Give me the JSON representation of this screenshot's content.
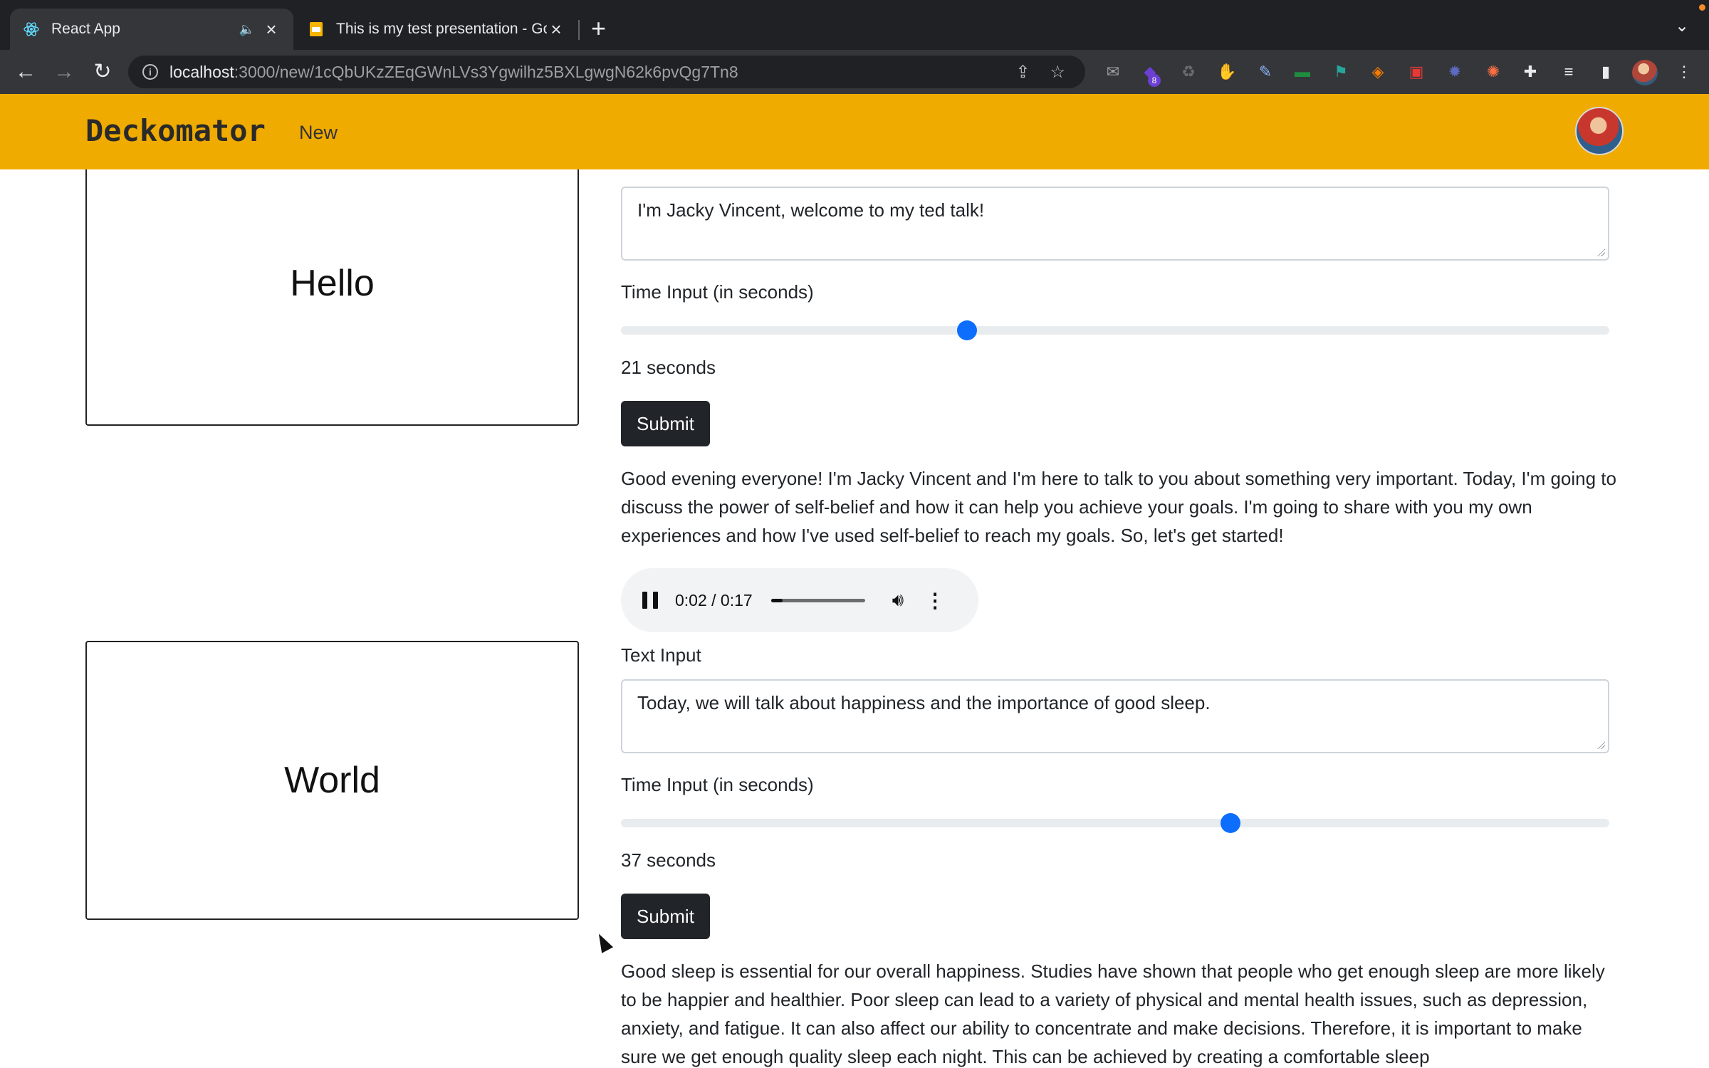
{
  "browser": {
    "tabs": [
      {
        "title": "React App",
        "active": true
      },
      {
        "title": "This is my test presentation - Google Slides",
        "active": false
      }
    ],
    "url_host": "localhost",
    "url_rest": ":3000/new/1cQbUKzZEqGWnLVs3Ygwilhz5BXLgwgN62k6pvQg7Tn8",
    "extension_badge": "8"
  },
  "app": {
    "brand": "Deckomator",
    "nav_new": "New"
  },
  "slides": [
    {
      "slide_text": "Hello",
      "text_value": "I'm Jacky Vincent, welcome to my ted talk!",
      "time_label": "Time Input (in seconds)",
      "time_value": 21,
      "seconds_text": "21 seconds",
      "submit_label": "Submit",
      "generated_text": "Good evening everyone! I'm Jacky Vincent and I'm here to talk to you about something very important. Today, I'm going to discuss the power of self-belief and how it can help you achieve your goals. I'm going to share with you my own experiences and how I've used self-belief to reach my goals. So, let's get started!",
      "audio": {
        "time": "0:02 / 0:17",
        "progress": 0.12
      }
    },
    {
      "slide_text": "World",
      "text_label": "Text Input",
      "text_value": "Today, we will talk about happiness and the importance of good sleep.",
      "time_label": "Time Input (in seconds)",
      "time_value": 37,
      "seconds_text": "37 seconds",
      "submit_label": "Submit",
      "generated_text": "Good sleep is essential for our overall happiness. Studies have shown that people who get enough sleep are more likely to be happier and healthier. Poor sleep can lead to a variety of physical and mental health issues, such as depression, anxiety, and fatigue. It can also affect our ability to concentrate and make decisions. Therefore, it is important to make sure we get enough quality sleep each night. This can be achieved by creating a comfortable sleep"
    }
  ],
  "slider": {
    "min": 0,
    "max": 60
  }
}
